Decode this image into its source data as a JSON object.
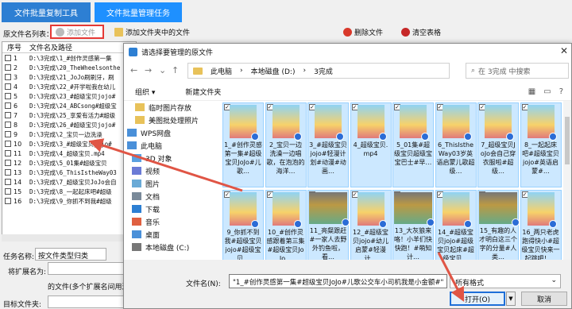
{
  "app": {
    "tabs": [
      "文件批量复制工具",
      "文件批量管理任务"
    ],
    "source_label": "原文件名列表：",
    "toolbar": {
      "add_file": "添加文件",
      "add_folder": "添加文件夹中的文件",
      "delete_file": "删除文件",
      "clear_table": "清空表格"
    },
    "table": {
      "col_no": "序号",
      "col_path": "文件名及路径",
      "rows": [
        {
          "no": "1",
          "path": "D:\\3完成\\1_#创作灵感第一集"
        },
        {
          "no": "2",
          "path": "D:\\3完成\\20_TheWheelsonthe"
        },
        {
          "no": "3",
          "path": "D:\\3完成\\21_JoJo刷刷牙，刷"
        },
        {
          "no": "4",
          "path": "D:\\3完成\\22_#开学啦我在幼儿"
        },
        {
          "no": "5",
          "path": "D:\\3完成\\23_#超级宝贝jojo#"
        },
        {
          "no": "6",
          "path": "D:\\3完成\\24_ABCsong#超级宝"
        },
        {
          "no": "7",
          "path": "D:\\3完成\\25_享爱有活力#超级"
        },
        {
          "no": "8",
          "path": "D:\\3完成\\26_#超级宝贝jojo#"
        },
        {
          "no": "9",
          "path": "D:\\3完成\\2_宝贝一边洗澡"
        },
        {
          "no": "10",
          "path": "D:\\3完成\\3_#超级宝贝jojo#"
        },
        {
          "no": "11",
          "path": "D:\\3完成\\4_超级宝贝.mp4"
        },
        {
          "no": "12",
          "path": "D:\\3完成\\5_01集#超级宝贝"
        },
        {
          "no": "13",
          "path": "D:\\3完成\\6_ThisIstheWay03"
        },
        {
          "no": "14",
          "path": "D:\\3完成\\7_超级宝贝JoJo会自"
        },
        {
          "no": "15",
          "path": "D:\\3完成\\8_一起起床吧#超级"
        },
        {
          "no": "16",
          "path": "D:\\3完成\\9_你抓不到我#超级"
        }
      ]
    },
    "task_type_label": "任务名称:",
    "task_type_value": "按文件类型归类",
    "ext_label": "将扩展名为:",
    "ext_note": "的文件(多个扩展名间用逗",
    "output_label": "目标文件夹:"
  },
  "dialog": {
    "title": "请选择要管理的原文件",
    "close": "✕",
    "path": [
      "此电脑",
      "本地磁盘 (D:)",
      "3完成"
    ],
    "search_placeholder": "在 3完成 中搜索",
    "organize": "组织 ▾",
    "new_folder": "新建文件夹",
    "nav": [
      "临时图片存放",
      "美图批处理照片",
      "WPS网盘",
      "此电脑",
      "3D 对象",
      "视频",
      "图片",
      "文档",
      "下载",
      "音乐",
      "桌面",
      "本地磁盘 (C:)"
    ],
    "files": [
      "1_#创作灵感第一集#超级宝贝JoJo#儿歌…",
      "2_宝贝一边洗澡一边唱歌，在泡泡的海洋…",
      "3_#超级宝贝jojo#轻漫计划#动漫#动画…",
      "4_超级宝贝.mp4",
      "5_01集#超级宝贝超级宝宝巴士#早…",
      "6_ThisIstheWay03岁英语启蒙儿歌超级…",
      "7_超级宝贝JoJo会自己穿衣服啦#超级…",
      "8_一起起床吧#超级宝贝jojo#英语启蒙#…",
      "9_你抓不到我#超级宝贝jojo#超级宝贝…",
      "10_#创作灵感跟着第三集#超级宝贝JoJo…",
      "11_亮粲跟赶#一家人去野外钓鱼啦，看…",
      "12_#超级宝贝jojo#幼儿启蒙#轻漫计…",
      "13_大灰狼来咯！小羊们快快跑！#萌知计…",
      "14_#超级宝贝jojo#超级宝贝起床#超级宝贝…",
      "15_有趣的人才明白这三个字的分量#人类…",
      "16_两只老虎跑得快小#超级宝贝快来一起跳吧！…"
    ],
    "filename_label": "文件名(N):",
    "filename_value": "\"1_#创作灵感第一集#超级宝贝JoJo#儿歌公交车小司机我是小金额#\"",
    "filetype": "所有格式",
    "open": "打开(O)",
    "cancel": "取消"
  },
  "colors": {
    "accent": "#1e90ff",
    "selection": "#cce8ff",
    "highlight_red": "#e53935"
  },
  "icons": {
    "add_file": "plus-circle-icon",
    "add_folder": "folder-plus-icon",
    "delete": "delete-icon",
    "clear": "clear-icon"
  }
}
